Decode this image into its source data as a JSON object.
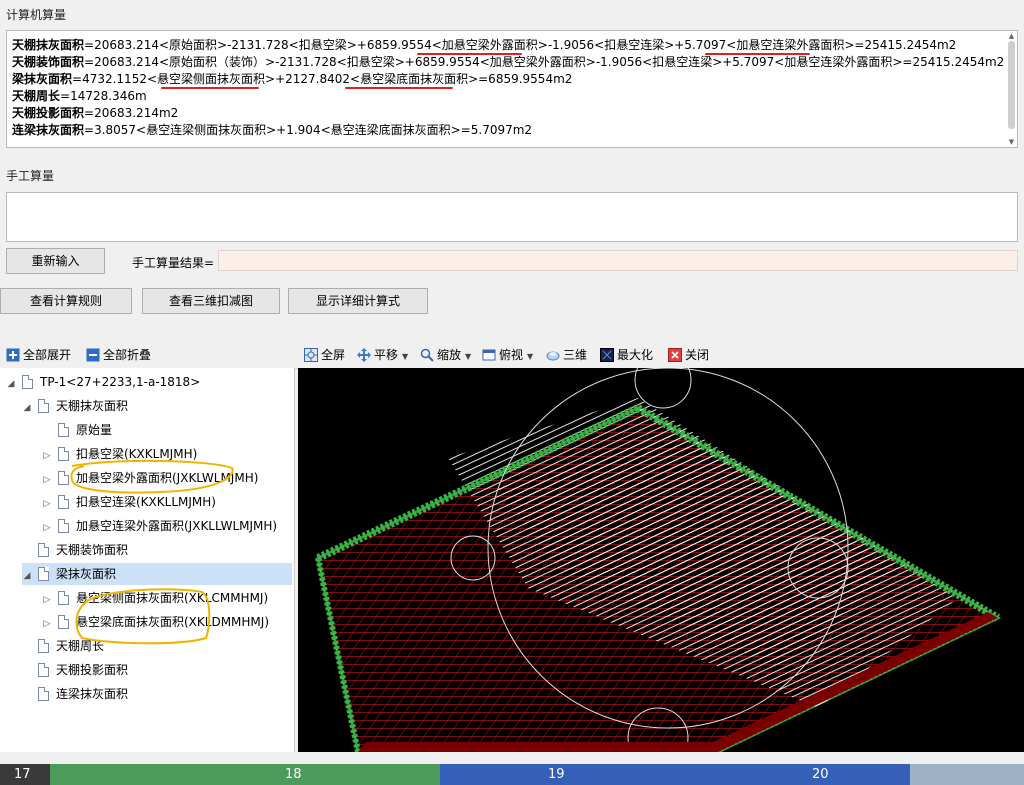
{
  "computer_calc": {
    "title": "计算机算量",
    "lines": [
      {
        "label": "天棚抹灰面积",
        "text": "=20683.214<原始面积>-2131.728<扣悬空梁>+6859.9554<加悬空梁外露面积>-1.9056<扣悬空连梁>+5.7097<加悬空连梁外露面积>=25415.2454m2"
      },
      {
        "label": "天棚装饰面积",
        "text": "=20683.214<原始面积（装饰）>-2131.728<扣悬空梁>+6859.9554<加悬空梁外露面积>-1.9056<扣悬空连梁>+5.7097<加悬空连梁外露面积>=25415.2454m2"
      },
      {
        "label": "梁抹灰面积",
        "text": "=4732.1152<悬空梁侧面抹灰面积>+2127.8402<悬空梁底面抹灰面积>=6859.9554m2"
      },
      {
        "label": "天棚周长",
        "text": "=14728.346m"
      },
      {
        "label": "天棚投影面积",
        "text": "=20683.214m2"
      },
      {
        "label": "连梁抹灰面积",
        "text": "=3.8057<悬空连梁侧面抹灰面积>+1.904<悬空连梁底面抹灰面积>=5.7097m2"
      }
    ]
  },
  "manual_calc": {
    "title": "手工算量",
    "reenter_label": "重新输入",
    "result_label": "手工算量结果=",
    "result_value": ""
  },
  "actions": {
    "view_rules": "查看计算规则",
    "view_3d": "查看三维扣减图",
    "show_detail": "显示详细计算式"
  },
  "tree_toolbar": {
    "expand_all": "全部展开",
    "collapse_all": "全部折叠"
  },
  "tree": {
    "root": "TP-1<27+2233,1-a-1818>",
    "items": [
      {
        "label": "天棚抹灰面积",
        "level": 1,
        "toggle": "◢"
      },
      {
        "label": "原始量",
        "level": 2,
        "toggle": ""
      },
      {
        "label": "扣悬空梁(KXKLMJMH)",
        "level": 2,
        "toggle": "▷"
      },
      {
        "label": "加悬空梁外露面积(JXKLWLMJMH)",
        "level": 2,
        "toggle": "▷"
      },
      {
        "label": "扣悬空连梁(KXKLLMJMH)",
        "level": 2,
        "toggle": "▷"
      },
      {
        "label": "加悬空连梁外露面积(JXKLLWLMJMH)",
        "level": 2,
        "toggle": "▷"
      },
      {
        "label": "天棚装饰面积",
        "level": 1,
        "toggle": ""
      },
      {
        "label": "梁抹灰面积",
        "level": 1,
        "toggle": "◢"
      },
      {
        "label": "悬空梁侧面抹灰面积(XKLCMMHMJ)",
        "level": 2,
        "toggle": "▷"
      },
      {
        "label": "悬空梁底面抹灰面积(XKLDMMHMJ)",
        "level": 2,
        "toggle": "▷"
      },
      {
        "label": "天棚周长",
        "level": 1,
        "toggle": ""
      },
      {
        "label": "天棚投影面积",
        "level": 1,
        "toggle": ""
      },
      {
        "label": "连梁抹灰面积",
        "level": 1,
        "toggle": ""
      }
    ]
  },
  "view_toolbar": {
    "fullscreen": "全屏",
    "pan": "平移",
    "zoom": "缩放",
    "view": "俯视",
    "three_d": "三维",
    "maximize": "最大化",
    "close": "关闭"
  },
  "bottom_strip": {
    "axis_numbers": [
      "17",
      "18",
      "19",
      "20"
    ]
  },
  "colors": {
    "accent_red_underline": "#e02020",
    "highlight_orange": "#f0b400",
    "selection": "#cce0f7",
    "result_field": "#fbefe7"
  }
}
